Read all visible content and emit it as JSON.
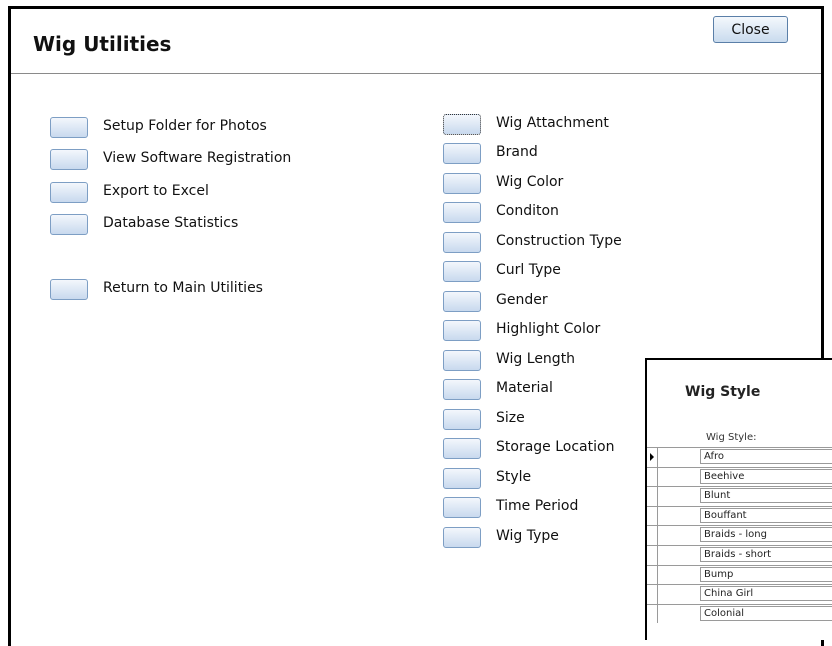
{
  "window": {
    "title": "Wig Utilities",
    "close_label": "Close"
  },
  "left_items": [
    "Setup Folder for Photos",
    "View Software Registration",
    "Export to Excel",
    "Database Statistics"
  ],
  "return_label": "Return to Main Utilities",
  "right_items": [
    "Wig Attachment",
    "Brand",
    "Wig Color",
    "Conditon",
    "Construction Type",
    "Curl Type",
    "Gender",
    "Highlight Color",
    "Wig Length",
    "Material",
    "Size",
    "Storage Location",
    "Style",
    "Time Period",
    "Wig Type"
  ],
  "wig_style_window": {
    "title": "Wig Style",
    "column_label": "Wig Style:",
    "rows": [
      "Afro",
      "Beehive",
      "Blunt",
      "Bouffant",
      "Braids - long",
      "Braids - short",
      "Bump",
      "China Girl",
      "Colonial"
    ]
  }
}
